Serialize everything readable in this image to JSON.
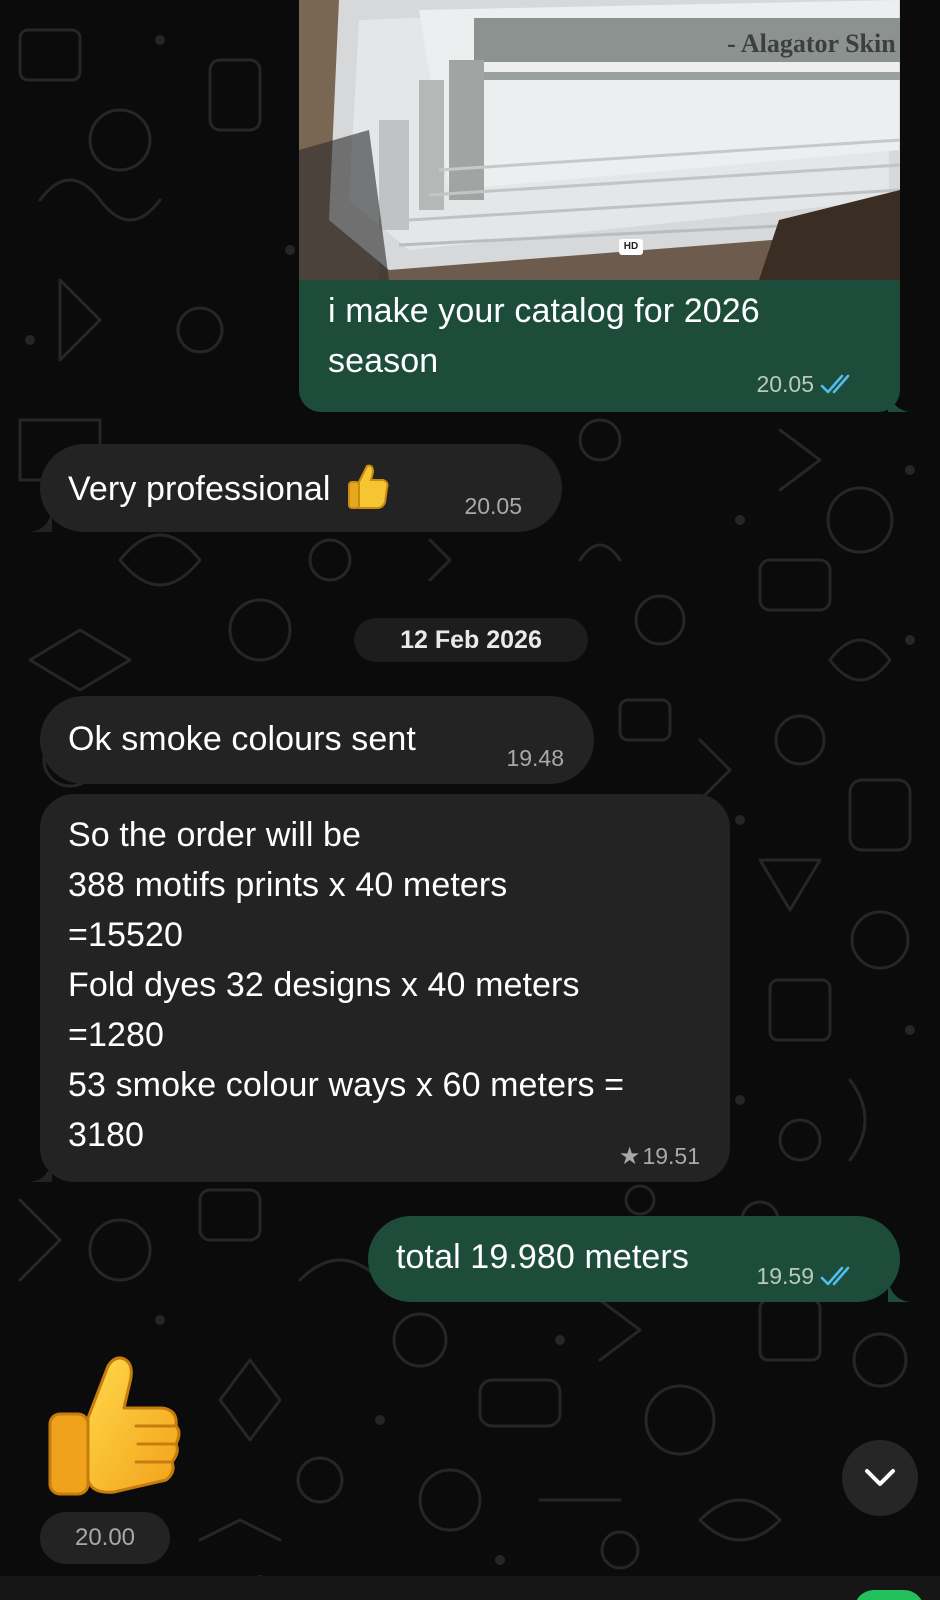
{
  "messages": {
    "photo": {
      "image_text": "- Alagator Skin -",
      "badge": "HD",
      "caption": "i make your catalog for 2026\nseason",
      "time": "20.05"
    },
    "very_professional": {
      "text": "Very professional",
      "emoji": "thumbs-up",
      "time": "20.05"
    },
    "smoke_sent": {
      "text": "Ok smoke colours sent",
      "time": "19.48"
    },
    "order": {
      "lines": [
        "So the order will be",
        "388 motifs prints x 40 meters",
        "=15520",
        "Fold dyes 32 designs x 40 meters",
        "=1280",
        "53 smoke colour ways x 60 meters =",
        "3180"
      ],
      "starred_marker": "★",
      "time": "19.51"
    },
    "total": {
      "text": "total 19.980 meters",
      "time": "19.59"
    },
    "thumb": {
      "emoji": "thumbs-up",
      "time": "20.00"
    }
  },
  "date_separator": "12 Feb 2026",
  "icons": {
    "read_receipt": "double-check-icon",
    "scroll_down": "chevron-down-icon"
  },
  "colors": {
    "background": "#0b0b0b",
    "incoming_bubble": "#232323",
    "outgoing_bubble": "#1d4d3a",
    "read_ticks": "#53bdeb",
    "meta_text": "#a7a9aa",
    "accent_green": "#23c05e"
  }
}
